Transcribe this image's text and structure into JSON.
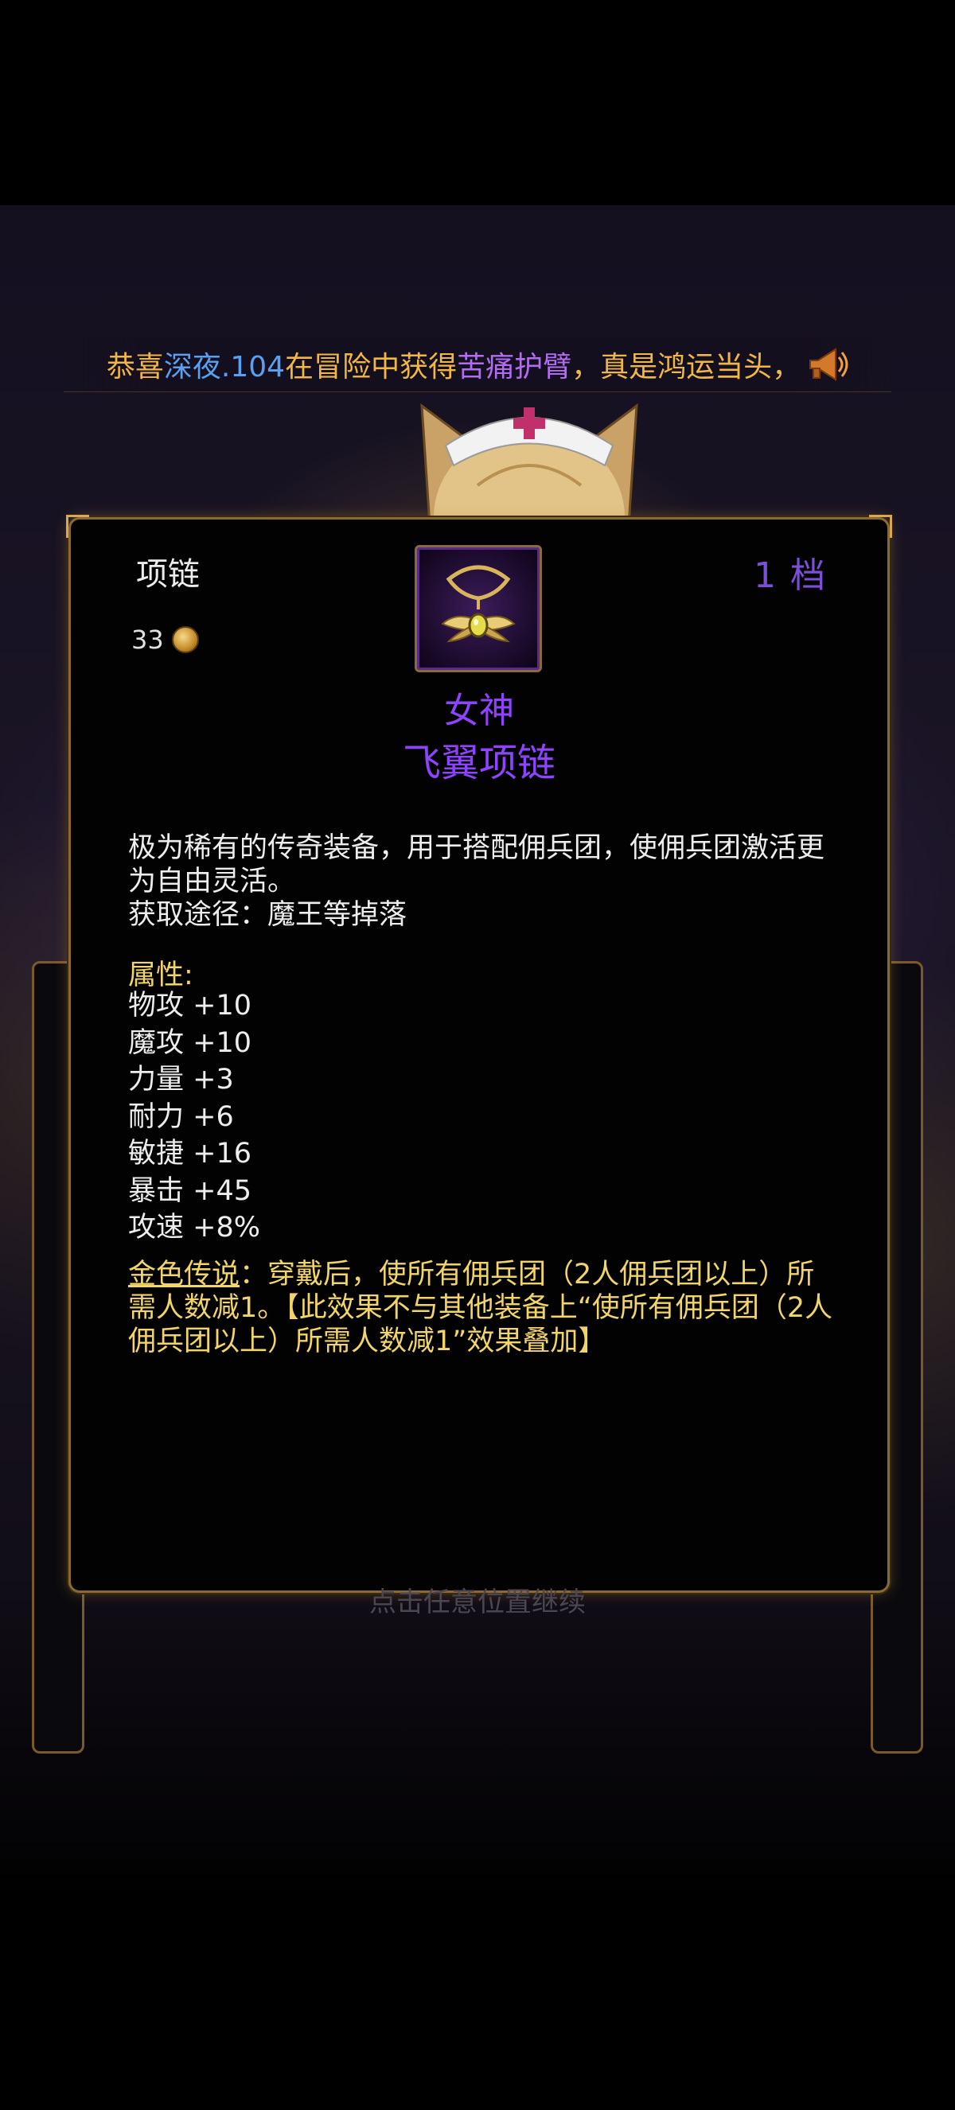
{
  "broadcast": {
    "segments": [
      {
        "text": "恭喜",
        "color": "gold"
      },
      {
        "text": "深夜.104",
        "color": "blue"
      },
      {
        "text": "在冒险中获得",
        "color": "gold"
      },
      {
        "text": "苦痛护臂",
        "color": "purple"
      },
      {
        "text": "，真是鸿运当头，",
        "color": "gold"
      }
    ],
    "icon": "horn-icon"
  },
  "item_card": {
    "slot": "项链",
    "price": "33",
    "price_icon": "gold-coin-icon",
    "grade": "1 档",
    "item_icon": "winged-necklace-icon",
    "name_line1": "女神",
    "name_line2": "飞翼项链",
    "description": "极为稀有的传奇装备，用于搭配佣兵团，使佣兵团激活更为自由灵活。",
    "source": "获取途径：魔王等掉落",
    "attributes_title": "属性:",
    "attributes": [
      "物攻 +10",
      "魔攻 +10",
      "力量 +3",
      "耐力 +6",
      "敏捷 +16",
      "暴击 +45",
      "攻速 +8%"
    ],
    "legend_label": "金色传说",
    "legend_text": "：穿戴后，使所有佣兵团（2人佣兵团以上）所需人数减1。【此效果不与其他装备上“使所有佣兵团（2人佣兵团以上）所需人数减1”效果叠加】"
  },
  "continue_hint": "点击任意位置继续",
  "colors": {
    "gold_text": "#f1d46a",
    "item_purple": "#8e44ff",
    "grade_purple": "#7b4fd6",
    "border_gold": "#8a6a32"
  }
}
